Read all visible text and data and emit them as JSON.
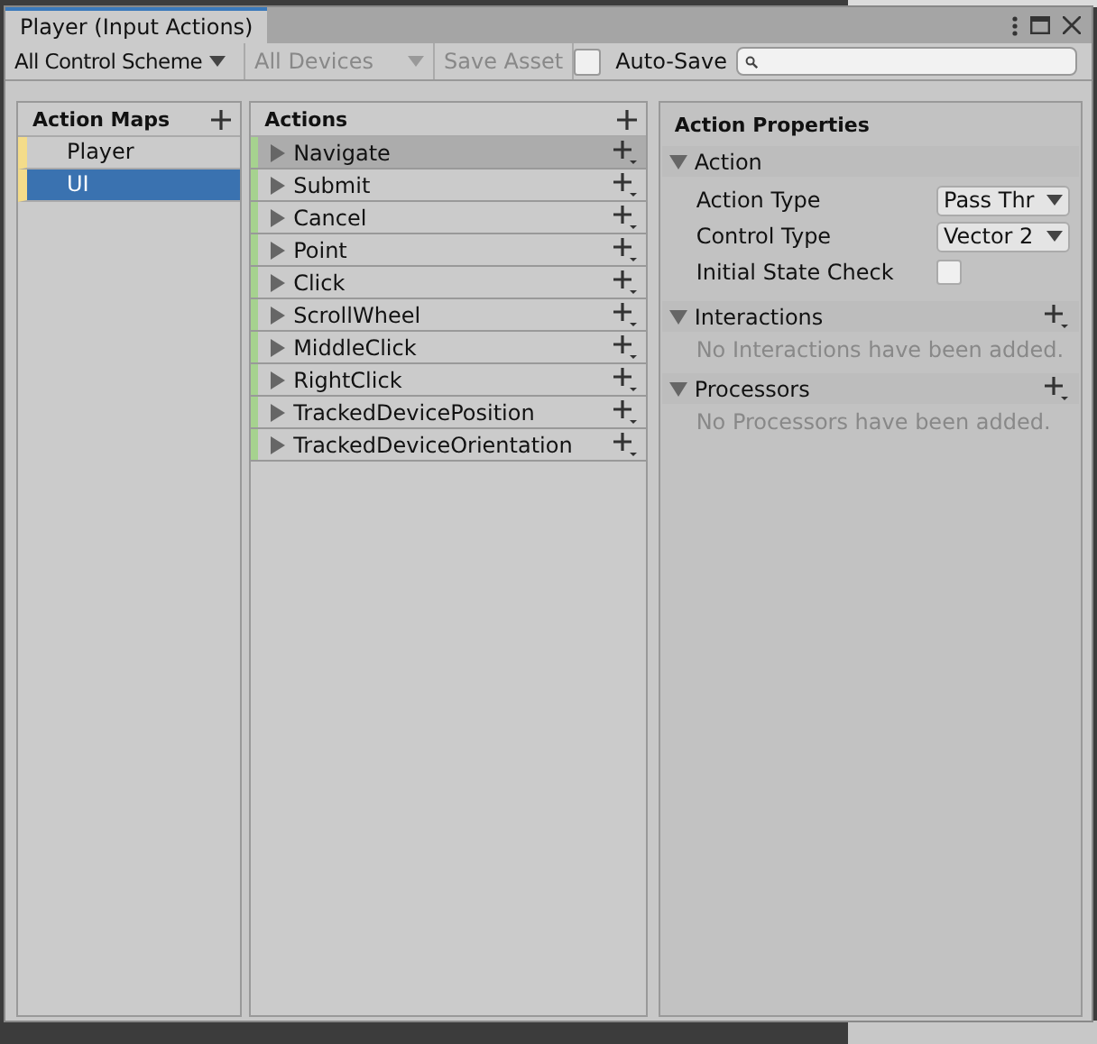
{
  "window": {
    "title": "Player (Input Actions)"
  },
  "toolbar": {
    "control_scheme": "All Control Scheme",
    "devices": {
      "label": "All Devices",
      "disabled": true
    },
    "save_button": {
      "label": "Save Asset",
      "disabled": true
    },
    "auto_save": {
      "label": "Auto-Save",
      "checked": false
    }
  },
  "action_maps": {
    "title": "Action Maps",
    "items": [
      {
        "label": "Player",
        "selected": false
      },
      {
        "label": "UI",
        "selected": true
      }
    ]
  },
  "actions": {
    "title": "Actions",
    "items": [
      {
        "label": "Navigate",
        "selected": true
      },
      {
        "label": "Submit",
        "selected": false
      },
      {
        "label": "Cancel",
        "selected": false
      },
      {
        "label": "Point",
        "selected": false
      },
      {
        "label": "Click",
        "selected": false
      },
      {
        "label": "ScrollWheel",
        "selected": false
      },
      {
        "label": "MiddleClick",
        "selected": false
      },
      {
        "label": "RightClick",
        "selected": false
      },
      {
        "label": "TrackedDevicePosition",
        "selected": false
      },
      {
        "label": "TrackedDeviceOrientation",
        "selected": false
      }
    ]
  },
  "properties": {
    "title": "Action Properties",
    "sections": [
      {
        "title": "Action",
        "kind": "fields",
        "expanded": true,
        "fields": [
          {
            "label": "Action Type",
            "kind": "dropdown",
            "value": "Pass Thr"
          },
          {
            "label": "Control Type",
            "kind": "dropdown",
            "value": "Vector 2"
          },
          {
            "label": "Initial State Check",
            "kind": "checkbox",
            "checked": false
          }
        ]
      },
      {
        "title": "Interactions",
        "kind": "list",
        "expanded": true,
        "empty_text": "No Interactions have been added."
      },
      {
        "title": "Processors",
        "kind": "list",
        "expanded": true,
        "empty_text": "No Processors have been added."
      }
    ]
  }
}
